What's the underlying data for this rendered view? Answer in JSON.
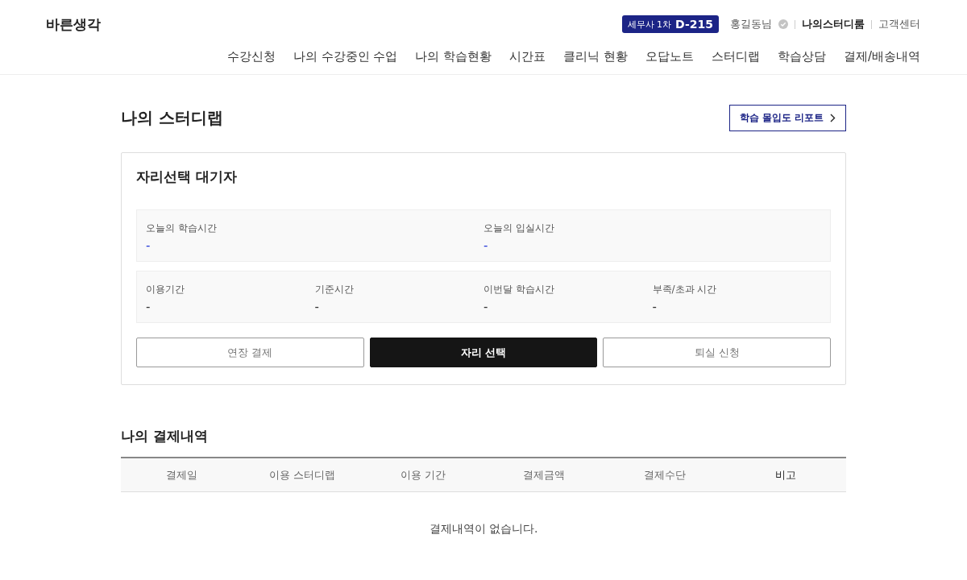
{
  "header": {
    "logo": "바른생각",
    "dday": {
      "label": "세무사 1차",
      "count": "D-215"
    },
    "user": "홍길동님",
    "links": [
      {
        "label": "나의스터디룸",
        "selected": true
      },
      {
        "label": "고객센터",
        "selected": false
      }
    ],
    "nav": [
      "수강신청",
      "나의 수강중인 수업",
      "나의 학습현황",
      "시간표",
      "클리닉 현황",
      "오답노트",
      "스터디랩",
      "학습상담",
      "결제/배송내역"
    ]
  },
  "page": {
    "title": "나의 스터디랩",
    "report_button": "학습 몰입도 리포트"
  },
  "status_card": {
    "title": "자리선택 대기자",
    "stat_groups": [
      {
        "highlight": true,
        "stats": [
          {
            "label": "오늘의 학습시간",
            "value": "-"
          },
          {
            "label": "오늘의 입실시간",
            "value": "-"
          }
        ]
      },
      {
        "highlight": false,
        "stats": [
          {
            "label": "이용기간",
            "value": "-"
          },
          {
            "label": "기준시간",
            "value": "-"
          },
          {
            "label": "이번달 학습시간",
            "value": "-"
          },
          {
            "label": "부족/초과 시간",
            "value": "-"
          }
        ]
      }
    ],
    "buttons": [
      {
        "label": "연장 결제",
        "kind": "outline"
      },
      {
        "label": "자리 선택",
        "kind": "primary"
      },
      {
        "label": "퇴실 신청",
        "kind": "outline"
      }
    ]
  },
  "payments": {
    "title": "나의 결제내역",
    "columns": [
      {
        "label": "결제일",
        "emphasized": false
      },
      {
        "label": "이용 스터디랩",
        "emphasized": false
      },
      {
        "label": "이용 기간",
        "emphasized": false
      },
      {
        "label": "결제금액",
        "emphasized": false
      },
      {
        "label": "결제수단",
        "emphasized": false
      },
      {
        "label": "비고",
        "emphasized": true
      }
    ],
    "empty_message": "결제내역이 없습니다."
  }
}
